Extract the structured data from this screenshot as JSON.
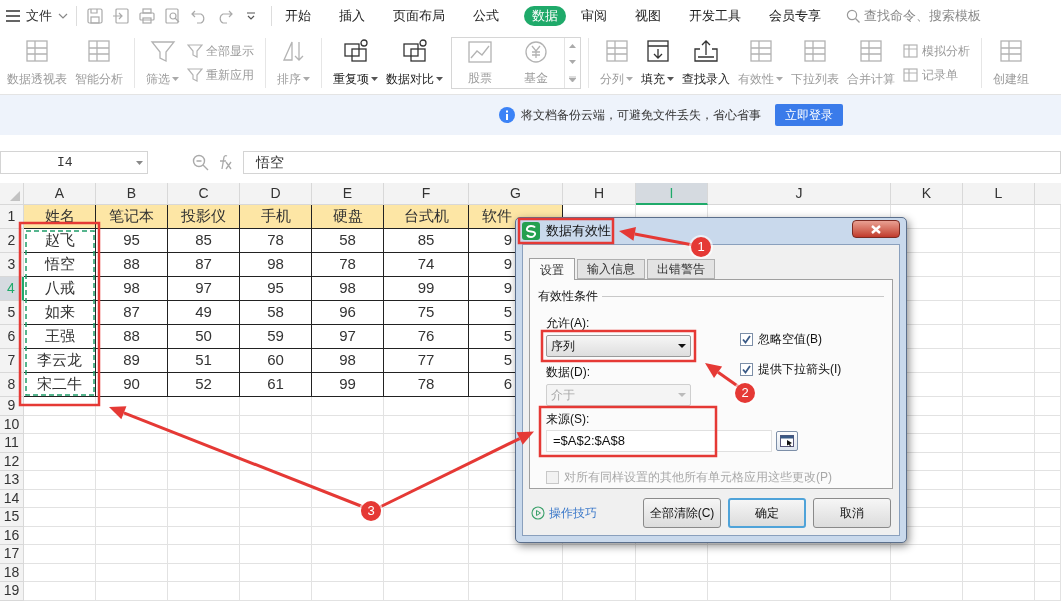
{
  "menu": {
    "file": "文件",
    "tabs": [
      {
        "label": "开始",
        "selected": false
      },
      {
        "label": "插入",
        "selected": false
      },
      {
        "label": "页面布局",
        "selected": false
      },
      {
        "label": "公式",
        "selected": false
      },
      {
        "label": "数据",
        "selected": true
      },
      {
        "label": "审阅",
        "selected": false
      },
      {
        "label": "视图",
        "selected": false
      },
      {
        "label": "开发工具",
        "selected": false
      },
      {
        "label": "会员专享",
        "selected": false
      }
    ],
    "search": {
      "placeholder": "查找命令、搜索模板"
    }
  },
  "ribbon_groups": [
    [
      {
        "kind": "big",
        "label": "数据透视表",
        "disabled": true,
        "dropdown": false
      },
      {
        "kind": "big",
        "label": "智能分析",
        "disabled": true,
        "dropdown": false
      }
    ],
    [
      {
        "kind": "big",
        "label": "筛选",
        "disabled": true,
        "dropdown": true
      },
      {
        "kind": "stack",
        "items": [
          {
            "label": "全部显示",
            "disabled": true
          },
          {
            "label": "重新应用",
            "disabled": true
          }
        ]
      }
    ],
    [
      {
        "kind": "big",
        "label": "排序",
        "disabled": true,
        "dropdown": true
      }
    ],
    [
      {
        "kind": "big",
        "label": "重复项",
        "disabled": false,
        "dropdown": true
      },
      {
        "kind": "big",
        "label": "数据对比",
        "disabled": false,
        "dropdown": true
      },
      {
        "kind": "gallery",
        "items": [
          {
            "label": "股票",
            "disabled": true
          },
          {
            "label": "基金",
            "disabled": true
          }
        ]
      }
    ],
    [
      {
        "kind": "big",
        "label": "分列",
        "disabled": true,
        "dropdown": true
      },
      {
        "kind": "big",
        "label": "填充",
        "disabled": false,
        "dropdown": true
      },
      {
        "kind": "big",
        "label": "查找录入",
        "disabled": false,
        "dropdown": false
      },
      {
        "kind": "big",
        "label": "有效性",
        "disabled": true,
        "dropdown": true
      },
      {
        "kind": "big",
        "label": "下拉列表",
        "disabled": true,
        "dropdown": false
      },
      {
        "kind": "big",
        "label": "合并计算",
        "disabled": true,
        "dropdown": false
      },
      {
        "kind": "stack",
        "items": [
          {
            "label": "模拟分析",
            "disabled": true
          },
          {
            "label": "记录单",
            "disabled": true
          }
        ]
      }
    ],
    [
      {
        "kind": "big",
        "label": "创建组",
        "disabled": true,
        "dropdown": false
      }
    ]
  ],
  "notice": {
    "text": "将文档备份云端，可避免文件丢失，省心省事",
    "button": "立即登录"
  },
  "formula_bar": {
    "cell": "I4",
    "value": "悟空"
  },
  "sheet": {
    "columns": [
      {
        "label": "A",
        "selected": false
      },
      {
        "label": "B",
        "selected": false
      },
      {
        "label": "C",
        "selected": false
      },
      {
        "label": "D",
        "selected": false
      },
      {
        "label": "E",
        "selected": false
      },
      {
        "label": "F",
        "selected": false
      },
      {
        "label": "G",
        "selected": false
      },
      {
        "label": "H",
        "selected": false
      },
      {
        "label": "I",
        "selected": true
      },
      {
        "label": "J",
        "selected": false
      },
      {
        "label": "K",
        "selected": false
      },
      {
        "label": "L",
        "selected": false
      }
    ],
    "rows": [
      {
        "header": "1",
        "selected": false,
        "cells": [
          "姓名",
          "笔记本",
          "投影仪",
          "手机",
          "硬盘",
          "台式机",
          "软件"
        ]
      },
      {
        "header": "2",
        "selected": false,
        "cells": [
          "赵飞",
          "95",
          "85",
          "78",
          "58",
          "85",
          "9"
        ]
      },
      {
        "header": "3",
        "selected": false,
        "cells": [
          "悟空",
          "88",
          "87",
          "98",
          "78",
          "74",
          "9"
        ]
      },
      {
        "header": "4",
        "selected": true,
        "cells": [
          "八戒",
          "98",
          "97",
          "95",
          "98",
          "99",
          "9"
        ]
      },
      {
        "header": "5",
        "selected": false,
        "cells": [
          "如来",
          "87",
          "49",
          "58",
          "96",
          "75",
          "5"
        ]
      },
      {
        "header": "6",
        "selected": false,
        "cells": [
          "王强",
          "88",
          "50",
          "59",
          "97",
          "76",
          "5"
        ]
      },
      {
        "header": "7",
        "selected": false,
        "cells": [
          "李云龙",
          "89",
          "51",
          "60",
          "98",
          "77",
          "5"
        ]
      },
      {
        "header": "8",
        "selected": false,
        "cells": [
          "宋二牛",
          "90",
          "52",
          "61",
          "99",
          "78",
          "6"
        ]
      },
      {
        "header": "9",
        "selected": false
      },
      {
        "header": "10",
        "selected": false
      },
      {
        "header": "11",
        "selected": false
      },
      {
        "header": "12",
        "selected": false
      },
      {
        "header": "13",
        "selected": false
      },
      {
        "header": "14",
        "selected": false
      },
      {
        "header": "15",
        "selected": false
      },
      {
        "header": "16",
        "selected": false
      },
      {
        "header": "17",
        "selected": false
      },
      {
        "header": "18",
        "selected": false
      },
      {
        "header": "19",
        "selected": false
      }
    ]
  },
  "dialog": {
    "title": "数据有效性",
    "tabs": [
      {
        "label": "设置",
        "selected": true
      },
      {
        "label": "输入信息",
        "selected": false
      },
      {
        "label": "出错警告",
        "selected": false
      }
    ],
    "section": "有效性条件",
    "allow_label": "允许(A):",
    "allow_value": "序列",
    "data_label": "数据(D):",
    "data_value": "介于",
    "data_disabled": true,
    "checkboxes": [
      {
        "label": "忽略空值(B)",
        "checked": true
      },
      {
        "label": "提供下拉箭头(I)",
        "checked": true
      }
    ],
    "source_label": "来源(S):",
    "source_value": "=$A$2:$A$8",
    "apply_all": {
      "label": "对所有同样设置的其他所有单元格应用这些更改(P)",
      "checked": false,
      "disabled": true
    },
    "tips": "操作技巧",
    "buttons": [
      {
        "label": "全部清除(C)",
        "default": false
      },
      {
        "label": "确定",
        "default": true
      },
      {
        "label": "取消",
        "default": false
      }
    ]
  },
  "annotations": [
    {
      "label": "1"
    },
    {
      "label": "2"
    },
    {
      "label": "3"
    }
  ]
}
